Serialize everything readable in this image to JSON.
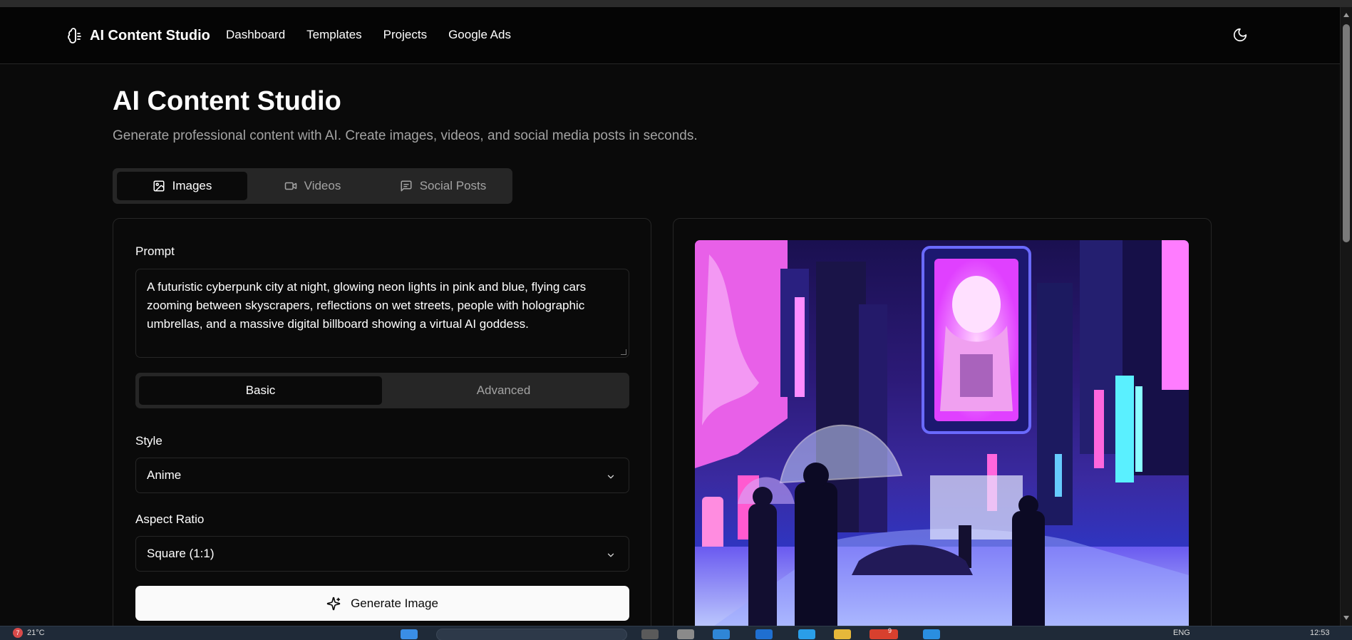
{
  "nav": {
    "brand": "AI Content Studio",
    "links": [
      "Dashboard",
      "Templates",
      "Projects",
      "Google Ads"
    ]
  },
  "header": {
    "title": "AI Content Studio",
    "subtitle": "Generate professional content with AI. Create images, videos, and social media posts in seconds."
  },
  "main_tabs": [
    {
      "label": "Images",
      "icon": "image-icon",
      "active": true
    },
    {
      "label": "Videos",
      "icon": "video-icon",
      "active": false
    },
    {
      "label": "Social Posts",
      "icon": "message-square-icon",
      "active": false
    }
  ],
  "form": {
    "prompt_label": "Prompt",
    "prompt_value": "A futuristic cyberpunk city at night, glowing neon lights in pink and blue, flying cars zooming between skyscrapers, reflections on wet streets, people with holographic umbrellas, and a massive digital billboard showing a virtual AI goddess.",
    "mode_tabs": [
      "Basic",
      "Advanced"
    ],
    "active_mode": "Basic",
    "style_label": "Style",
    "style_value": "Anime",
    "aspect_label": "Aspect Ratio",
    "aspect_value": "Square (1:1)",
    "generate_label": "Generate Image"
  },
  "preview": {
    "icon": "generated-image"
  },
  "taskbar": {
    "weather_badge": "7",
    "weather_temp": "21°C",
    "search_badge": "9",
    "language": "ENG",
    "time": "12:53"
  },
  "colors": {
    "background": "#0a0a0a",
    "border": "#262626",
    "muted_text": "#a3a3a3",
    "primary_button": "#fafafa"
  }
}
